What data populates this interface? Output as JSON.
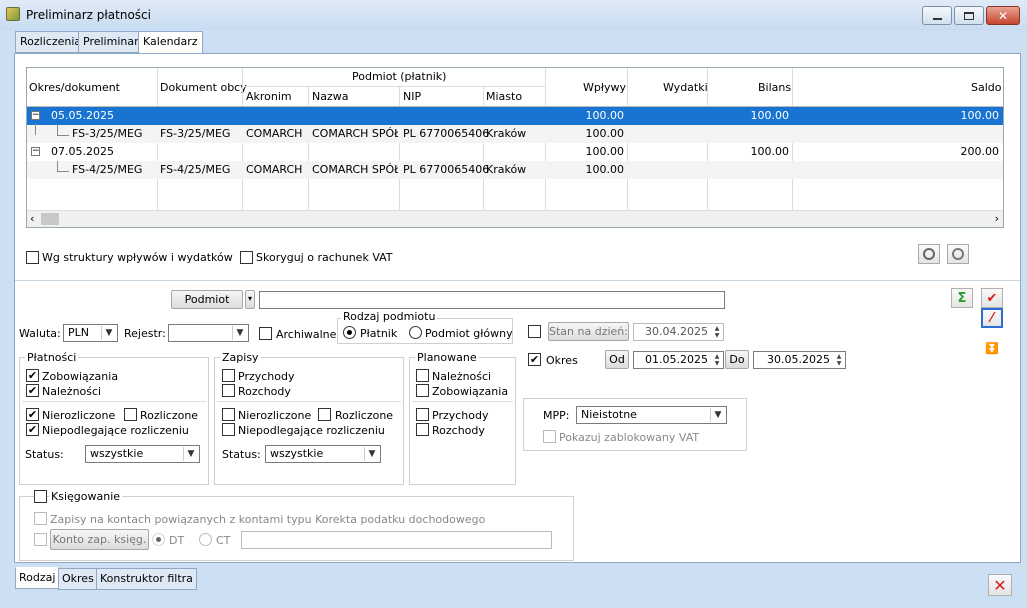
{
  "window": {
    "title": "Preliminarz płatności"
  },
  "tabs": [
    "Rozliczenia",
    "Preliminarz",
    "Kalendarz"
  ],
  "grid": {
    "headers": {
      "okres": "Okres/dokument",
      "obcy": "Dokument obcy",
      "podmiot": "Podmiot (płatnik)",
      "akronim": "Akronim",
      "nazwa": "Nazwa",
      "nip": "NIP",
      "miasto": "Miasto",
      "wplywy": "Wpływy",
      "wydatki": "Wydatki",
      "bilans": "Bilans",
      "saldo": "Saldo"
    },
    "rows": [
      {
        "okres": "05.05.2025",
        "obcy": "",
        "akronim": "",
        "nazwa": "",
        "nip": "",
        "miasto": "",
        "wplywy": "100.00",
        "wydatki": "",
        "bilans": "100.00",
        "saldo": "100.00",
        "level": 0,
        "selected": true
      },
      {
        "okres": "FS-3/25/MEG",
        "obcy": "FS-3/25/MEG",
        "akronim": "COMARCH",
        "nazwa": "COMARCH SPÓŁK",
        "nip": "PL 6770065406",
        "miasto": "Kraków",
        "wplywy": "100.00",
        "wydatki": "",
        "bilans": "",
        "saldo": "",
        "level": 1,
        "selected": false
      },
      {
        "okres": "07.05.2025",
        "obcy": "",
        "akronim": "",
        "nazwa": "",
        "nip": "",
        "miasto": "",
        "wplywy": "100.00",
        "wydatki": "",
        "bilans": "100.00",
        "saldo": "200.00",
        "level": 0,
        "selected": false
      },
      {
        "okres": "FS-4/25/MEG",
        "obcy": "FS-4/25/MEG",
        "akronim": "COMARCH",
        "nazwa": "COMARCH SPÓŁK",
        "nip": "PL 6770065406",
        "miasto": "Kraków",
        "wplywy": "100.00",
        "wydatki": "",
        "bilans": "",
        "saldo": "",
        "level": 1,
        "selected": false
      }
    ]
  },
  "options": {
    "wg_struktury": "Wg struktury wpływów i wydatków",
    "skoryguj": "Skoryguj o rachunek VAT"
  },
  "filter": {
    "podmiot_btn": "Podmiot",
    "podmiot_value": "",
    "rodzaj_title": "Rodzaj podmiotu",
    "platnik": "Płatnik",
    "podmiot_glowny": "Podmiot główny",
    "waluta_label": "Waluta:",
    "waluta_value": "PLN",
    "rejestr_label": "Rejestr:",
    "rejestr_value": "",
    "archiwalne": "Archiwalne",
    "stan_btn": "Stan na dzień:",
    "stan_value": "30.04.2025",
    "okres_label": "Okres",
    "od_btn": "Od",
    "od_value": "01.05.2025",
    "do_btn": "Do",
    "do_value": "30.05.2025",
    "platnosci": {
      "title": "Płatności",
      "zobowiazania": "Zobowiązania",
      "naleznosci": "Należności",
      "nierozliczone": "Nierozliczone",
      "rozliczone": "Rozliczone",
      "niepodlegajace": "Niepodlegające rozliczeniu",
      "status_label": "Status:",
      "status_value": "wszystkie"
    },
    "zapisy": {
      "title": "Zapisy",
      "przychody": "Przychody",
      "rozchody": "Rozchody",
      "nierozliczone": "Nierozliczone",
      "rozliczone": "Rozliczone",
      "niepodlegajace": "Niepodlegające rozliczeniu",
      "status_label": "Status:",
      "status_value": "wszystkie"
    },
    "planowane": {
      "title": "Planowane",
      "naleznosci": "Należności",
      "zobowiazania": "Zobowiązania",
      "przychody": "Przychody",
      "rozchody": "Rozchody"
    },
    "mpp_label": "MPP:",
    "mpp_value": "Nieistotne",
    "pokazuj_vat": "Pokazuj zablokowany VAT",
    "ksiegowanie": "Księgowanie",
    "zapisy_kontach": "Zapisy na kontach powiązanych z kontami typu Korekta podatku dochodowego",
    "konto_btn": "Konto zap. księg.",
    "dt": "DT",
    "ct": "CT",
    "konto_value": ""
  },
  "bottom_tabs": [
    "Rodzaj",
    "Okres",
    "Konstruktor filtra"
  ],
  "colors": {
    "selection": "#1874d0",
    "accent": "#cde0f3"
  }
}
